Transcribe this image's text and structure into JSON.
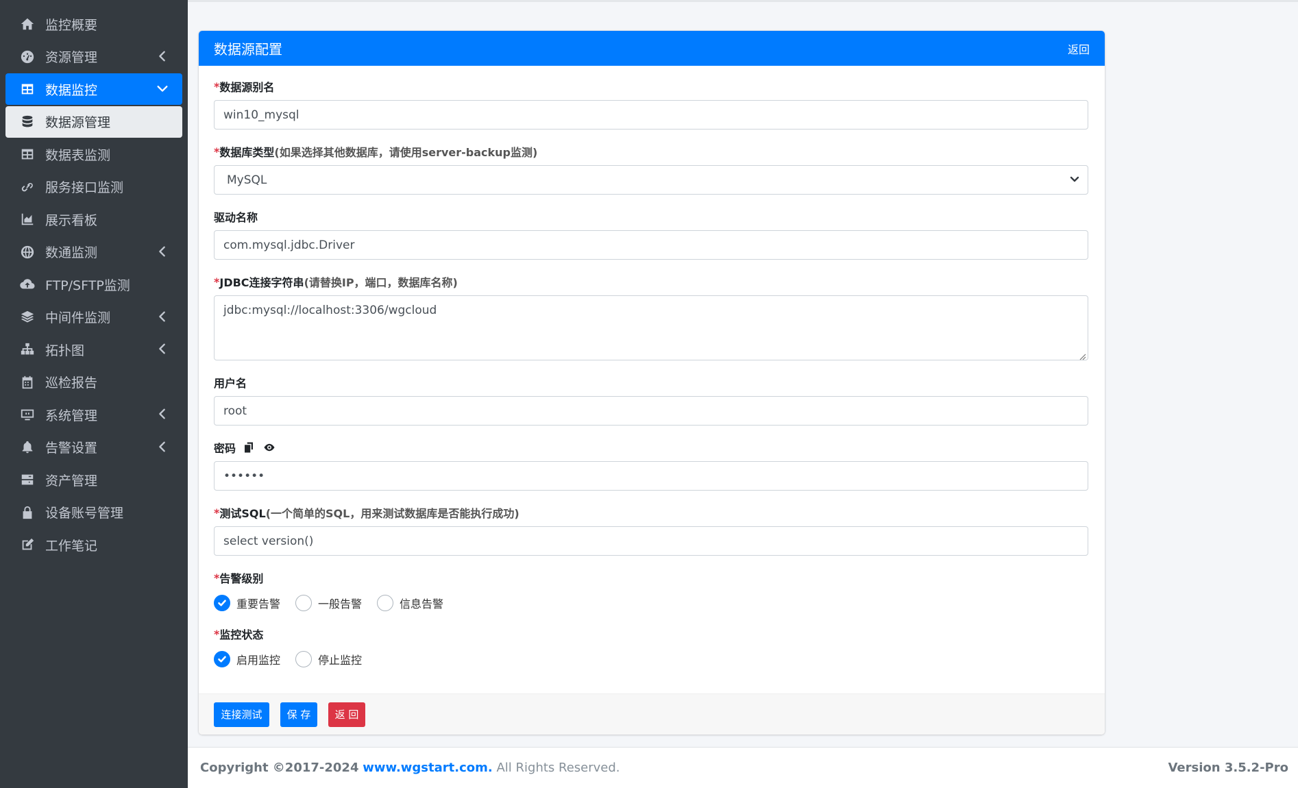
{
  "sidebar": {
    "items": [
      {
        "label": "监控概要",
        "icon": "home-icon"
      },
      {
        "label": "资源管理",
        "icon": "tachometer-icon"
      },
      {
        "label": "数据监控",
        "icon": "table-icon"
      },
      {
        "label": "数据源管理",
        "icon": "database-icon"
      },
      {
        "label": "数据表监测",
        "icon": "table-icon"
      },
      {
        "label": "服务接口监测",
        "icon": "link-icon"
      },
      {
        "label": "展示看板",
        "icon": "chart-area-icon"
      },
      {
        "label": "数通监测",
        "icon": "globe-icon"
      },
      {
        "label": "FTP/SFTP监测",
        "icon": "cloud-upload-icon"
      },
      {
        "label": "中间件监测",
        "icon": "layers-icon"
      },
      {
        "label": "拓扑图",
        "icon": "sitemap-icon"
      },
      {
        "label": "巡检报告",
        "icon": "calendar-icon"
      },
      {
        "label": "系统管理",
        "icon": "monitor-icon"
      },
      {
        "label": "告警设置",
        "icon": "bell-icon"
      },
      {
        "label": "资产管理",
        "icon": "server-icon"
      },
      {
        "label": "设备账号管理",
        "icon": "lock-icon"
      },
      {
        "label": "工作笔记",
        "icon": "edit-icon"
      }
    ]
  },
  "card": {
    "title": "数据源配置",
    "back_link": "返回"
  },
  "form": {
    "alias": {
      "required": "*",
      "label": "数据源别名",
      "value": "win10_mysql"
    },
    "db_type": {
      "required": "*",
      "label": "数据库类型",
      "hint": "(如果选择其他数据库，请使用server-backup监测)",
      "value": "MySQL"
    },
    "driver": {
      "label": "驱动名称",
      "value": "com.mysql.jdbc.Driver"
    },
    "jdbc": {
      "required": "*",
      "label": "JDBC连接字符串",
      "hint": "(请替换IP，端口，数据库名称)",
      "value": "jdbc:mysql://localhost:3306/wgcloud"
    },
    "username": {
      "label": "用户名",
      "value": "root"
    },
    "password": {
      "label": "密码",
      "value": "••••••"
    },
    "test_sql": {
      "required": "*",
      "label": "测试SQL",
      "hint": "(一个简单的SQL，用来测试数据库是否能执行成功)",
      "value": "select version()"
    },
    "alarm_level": {
      "required": "*",
      "label": "告警级别",
      "options": [
        "重要告警",
        "一般告警",
        "信息告警"
      ],
      "selected": "重要告警"
    },
    "monitor_status": {
      "required": "*",
      "label": "监控状态",
      "options": [
        "启用监控",
        "停止监控"
      ],
      "selected": "启用监控"
    }
  },
  "buttons": {
    "test_connection": "连接测试",
    "save": "保 存",
    "back": "返 回"
  },
  "footer": {
    "copyright": "Copyright ©2017-2024",
    "link": "www.wgstart.com.",
    "rights": "All Rights Reserved.",
    "version": "Version 3.5.2-Pro"
  },
  "colors": {
    "primary": "#007bff",
    "danger": "#dc3545",
    "sidebar_bg": "#343a40"
  }
}
